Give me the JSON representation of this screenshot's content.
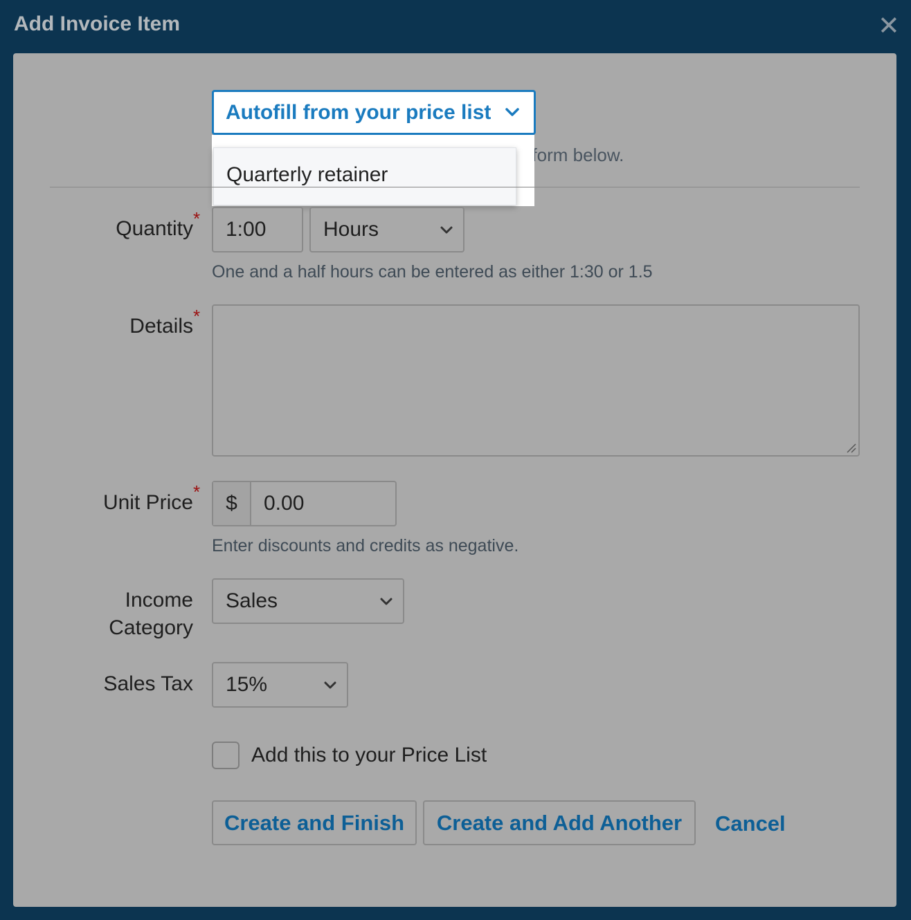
{
  "dialog": {
    "title": "Add Invoice Item",
    "close_icon": "close-icon"
  },
  "autofill": {
    "button_label": "Autofill from your price list",
    "hint_visible_fragment": "y fill in the form below.",
    "menu_items": [
      "Quarterly retainer"
    ]
  },
  "quantity": {
    "label": "Quantity",
    "required_mark": "*",
    "value": "1:00",
    "unit_selected": "Hours",
    "help": "One and a half hours can be entered as either 1:30 or 1.5"
  },
  "details": {
    "label": "Details",
    "required_mark": "*",
    "value": ""
  },
  "unit_price": {
    "label": "Unit Price",
    "required_mark": "*",
    "currency_symbol": "$",
    "value": "0.00",
    "help": "Enter discounts and credits as negative."
  },
  "income_category": {
    "label_line1": "Income",
    "label_line2": "Category",
    "selected": "Sales"
  },
  "sales_tax": {
    "label": "Sales Tax",
    "selected": "15%"
  },
  "price_list_checkbox": {
    "label": "Add this to your Price List",
    "checked": false
  },
  "actions": {
    "create_finish": "Create and Finish",
    "create_another": "Create and Add Another",
    "cancel": "Cancel"
  },
  "colors": {
    "header_bg": "#0c3450",
    "panel_bg": "#a9a9a9",
    "accent": "#1a7bbf",
    "button_text": "#0d5f96",
    "required": "#9b1010"
  }
}
